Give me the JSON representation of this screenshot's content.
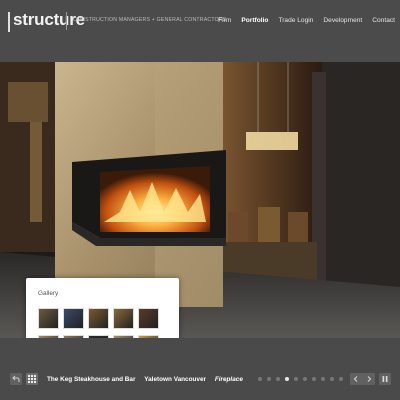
{
  "header": {
    "logo": "structure",
    "tagline": "CONSTRUCTION MANAGERS + GENERAL CONTRACTORS",
    "nav": [
      {
        "label": "Firm",
        "active": false
      },
      {
        "label": "Portfolio",
        "active": true
      },
      {
        "label": "Trade Login",
        "active": false
      },
      {
        "label": "Development",
        "active": false
      },
      {
        "label": "Contact",
        "active": false
      }
    ]
  },
  "gallery": {
    "title": "Gallery",
    "thumb_count": 10,
    "thumb_colors": [
      "#6b5a40",
      "#3a4a6a",
      "#7a5a30",
      "#8a6a3a",
      "#5a3a2a",
      "#9a8a6a",
      "#8a7a5a",
      "#2a2a2a",
      "#a88a6a",
      "#c89a4a"
    ]
  },
  "footer": {
    "caption": {
      "project": "The Keg Steakhouse and Bar",
      "location": "Yaletown Vancouver",
      "feature": "Fireplace"
    },
    "slide_count": 10,
    "active_slide": 3,
    "icons": {
      "back": "back-arrow-icon",
      "grid": "grid-icon",
      "prev": "prev-arrow-icon",
      "next": "next-arrow-icon",
      "pause": "pause-icon"
    }
  }
}
